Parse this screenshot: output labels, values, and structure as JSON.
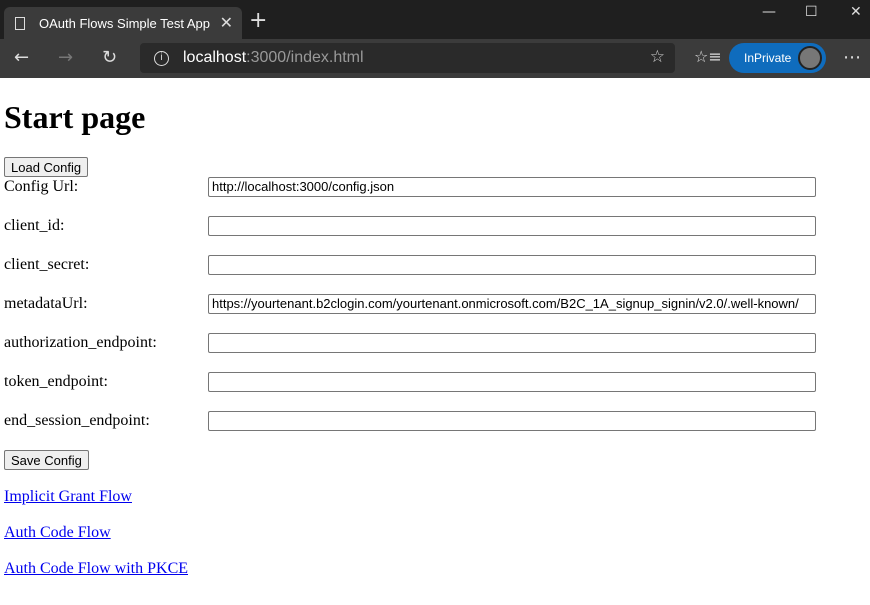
{
  "browser": {
    "tab_title": "OAuth Flows Simple Test App",
    "url_host": "localhost",
    "url_rest": ":3000/index.html",
    "inprivate_label": "InPrivate"
  },
  "page": {
    "title": "Start page",
    "load_button": "Load Config",
    "fields": [
      {
        "label": "Config Url:",
        "value": "http://localhost:3000/config.json"
      },
      {
        "label": "client_id:",
        "value": ""
      },
      {
        "label": "client_secret:",
        "value": ""
      },
      {
        "label": "metadataUrl:",
        "value": "https://yourtenant.b2clogin.com/yourtenant.onmicrosoft.com/B2C_1A_signup_signin/v2.0/.well-known/"
      },
      {
        "label": "authorization_endpoint:",
        "value": ""
      },
      {
        "label": "token_endpoint:",
        "value": ""
      },
      {
        "label": "end_session_endpoint:",
        "value": ""
      }
    ],
    "save_button": "Save Config",
    "links": [
      "Implicit Grant Flow",
      "Auth Code Flow",
      "Auth Code Flow with PKCE"
    ]
  }
}
